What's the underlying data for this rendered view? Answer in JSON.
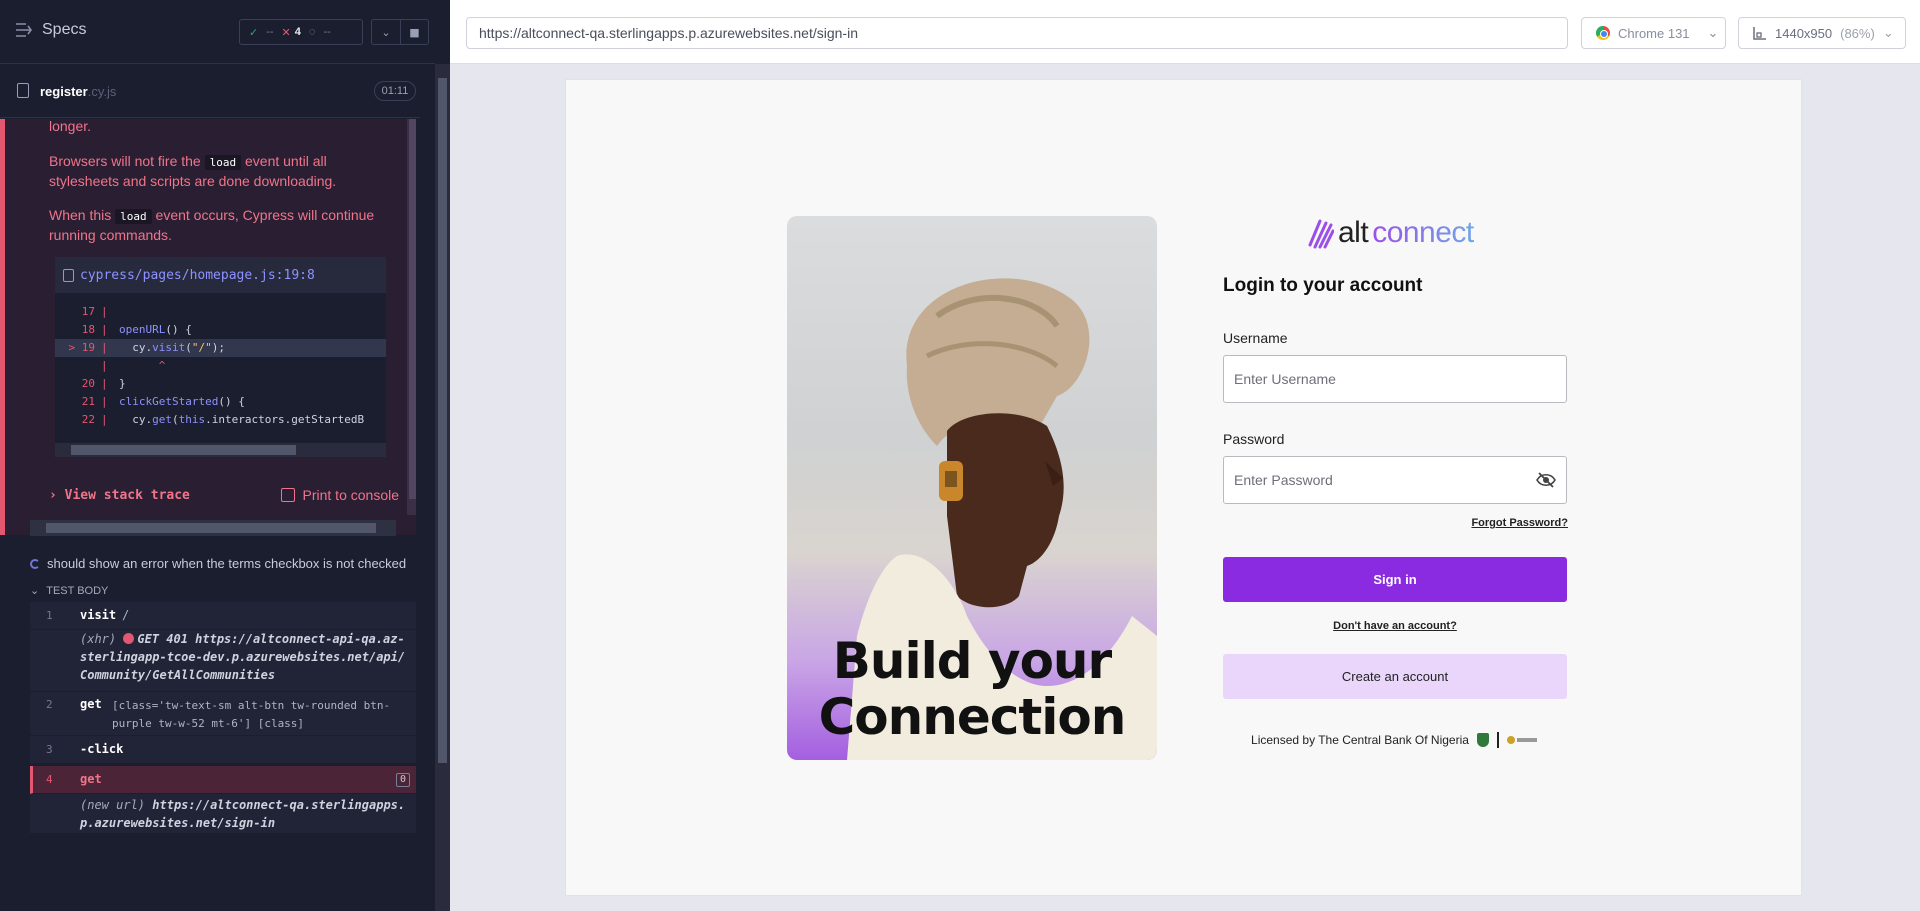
{
  "runner": {
    "specs_label": "Specs",
    "stats": {
      "passed": "--",
      "failed": "4",
      "pending": "--"
    },
    "file": {
      "name": "register",
      "ext": ".cy.js",
      "time": "01:11"
    }
  },
  "error": {
    "line_longer": "longer.",
    "p1_before": "Browsers will not fire the ",
    "p1_code": "load",
    "p1_after": " event until all stylesheets and scripts are done downloading.",
    "p2_before": "When this ",
    "p2_code": "load",
    "p2_after": " event occurs, Cypress will continue running commands.",
    "code_file": "cypress/pages/homepage.js:19:8",
    "code_lines": [
      {
        "num": "17",
        "src": ""
      },
      {
        "num": "18",
        "src": "openURL() {"
      },
      {
        "num": "> 19",
        "src": "  cy.visit(\"/\");"
      },
      {
        "num": "",
        "src": "      ^"
      },
      {
        "num": "20",
        "src": "}"
      },
      {
        "num": "21",
        "src": "clickGetStarted() {"
      },
      {
        "num": "22",
        "src": "  cy.get(this.interactors.getStartedB"
      }
    ],
    "view_stack": "View stack trace",
    "print_console": "Print to console"
  },
  "test": {
    "title": "should show an error when the terms checkbox is not checked",
    "body_label": "TEST BODY",
    "commands": [
      {
        "n": "1",
        "name": "visit",
        "msg": "/"
      },
      {
        "sub_label": "(xhr)",
        "sub_text": "GET 401 https://altconnect-api-qa.az-sterlingapp-tcoe-dev.p.azurewebsites.net/api/Community/GetAllCommunities"
      },
      {
        "n": "2",
        "name": "get",
        "msg": "[class='tw-text-sm alt-btn tw-rounded btn-purple tw-w-52 mt-6'] [class]"
      },
      {
        "n": "3",
        "name": "-click",
        "msg": ""
      },
      {
        "n": "4",
        "name": "get",
        "msg": "",
        "badge": "0"
      },
      {
        "sub_label": "(new url)",
        "sub_text": "https://altconnect-qa.sterlingapps.p.azurewebsites.net/sign-in"
      }
    ]
  },
  "browser": {
    "url": "https://altconnect-qa.sterlingapps.p.azurewebsites.net/sign-in",
    "name": "Chrome 131",
    "viewport": "1440x950",
    "zoom": "(86%)"
  },
  "app": {
    "tagline_1": "Build your",
    "tagline_2": "Connection",
    "logo_alt": "alt",
    "logo_connect": "connect",
    "heading": "Login to your account",
    "username_label": "Username",
    "username_placeholder": "Enter Username",
    "password_label": "Password",
    "password_placeholder": "Enter Password",
    "forgot": "Forgot Password?",
    "signin": "Sign in",
    "no_account": "Don't have an account?",
    "create": "Create an account",
    "licensed": "Licensed by The Central Bank Of Nigeria"
  },
  "colors": {
    "accent": "#8a2be2",
    "error": "#e45770",
    "pass": "#1fa971"
  }
}
